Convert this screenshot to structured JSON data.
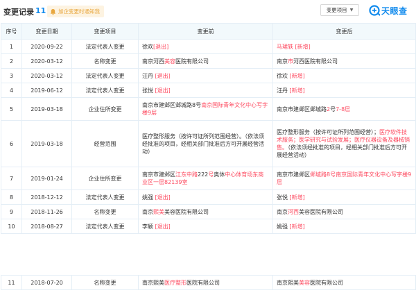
{
  "header": {
    "title": "变更记录",
    "count": "11",
    "notify_label": "加企变更时通知我",
    "dropdown_label": "变更项目",
    "logo_text": "天眼查"
  },
  "columns": [
    "序号",
    "变更日期",
    "变更项目",
    "变更前",
    "变更后"
  ],
  "rows": [
    {
      "no": "1",
      "date": "2020-09-22",
      "item": "法定代表人变更",
      "before": [
        {
          "t": "徐欢"
        },
        {
          "t": "[退出]",
          "hl": true
        }
      ],
      "after": [
        {
          "t": "马珺轶",
          "hl": true
        },
        {
          "t": " [新增]",
          "hl": true
        }
      ]
    },
    {
      "no": "2",
      "date": "2020-03-12",
      "item": "名称变更",
      "before": [
        {
          "t": "南京河西"
        },
        {
          "t": "美容",
          "hl": true
        },
        {
          "t": "医院有限公司"
        }
      ],
      "after": [
        {
          "t": "南京"
        },
        {
          "t": "市",
          "hl": true
        },
        {
          "t": "河西医院有限公司"
        }
      ]
    },
    {
      "no": "3",
      "date": "2020-03-12",
      "item": "法定代表人变更",
      "before": [
        {
          "t": "汪丹 "
        },
        {
          "t": "[退出]",
          "hl": true
        }
      ],
      "after": [
        {
          "t": "徐欢 "
        },
        {
          "t": "[新增]",
          "hl": true
        }
      ]
    },
    {
      "no": "4",
      "date": "2019-06-12",
      "item": "法定代表人变更",
      "before": [
        {
          "t": "张悦 "
        },
        {
          "t": "[退出]",
          "hl": true
        }
      ],
      "after": [
        {
          "t": "汪丹 "
        },
        {
          "t": "[新增]",
          "hl": true
        }
      ]
    },
    {
      "no": "5",
      "date": "2019-03-18",
      "item": "企业住所变更",
      "before": [
        {
          "t": "南京市建邺区邺城路8号"
        },
        {
          "t": "南京国际青年文化中心写字楼9层",
          "hl": true
        }
      ],
      "after": [
        {
          "t": "南京市建邺区邺城路"
        },
        {
          "t": "2",
          "hl": true
        },
        {
          "t": "号"
        },
        {
          "t": "7-8层",
          "hl": true
        }
      ]
    },
    {
      "no": "6",
      "date": "2019-03-18",
      "item": "经营范围",
      "before": [
        {
          "t": "医疗整形服务（按许可证所列范围经营）。（依法须经批准的项目，经相关部门批准后方可开展经营活动）"
        }
      ],
      "after": [
        {
          "t": "医疗整形服务（按许可证所列范围经营）；"
        },
        {
          "t": "医疗软件技术服务；医学研究与试验发展；医疗仪器设备及器械销售。",
          "hl": true
        },
        {
          "t": "（依法须经批准的项目，经相关部门批准后方可开展经营活动）"
        }
      ]
    },
    {
      "no": "7",
      "date": "2019-01-24",
      "item": "企业住所变更",
      "before": [
        {
          "t": "南京市建邺区"
        },
        {
          "t": "江东中路",
          "hl": true
        },
        {
          "t": "222"
        },
        {
          "t": "号",
          "hl": true
        },
        {
          "t": "奥体"
        },
        {
          "t": "中心体育场东商业区一层82139室",
          "hl": true
        }
      ],
      "after": [
        {
          "t": "南京市建邺区"
        },
        {
          "t": "邺城路8号南京国际青年文化",
          "hl": true
        },
        {
          "t": "中心写字楼9层",
          "hl": true
        }
      ]
    },
    {
      "no": "8",
      "date": "2018-12-12",
      "item": "法定代表人变更",
      "before": [
        {
          "t": "姚强 "
        },
        {
          "t": "[退出]",
          "hl": true
        }
      ],
      "after": [
        {
          "t": "张悦 "
        },
        {
          "t": "[新增]",
          "hl": true
        }
      ]
    },
    {
      "no": "9",
      "date": "2018-11-26",
      "item": "名称变更",
      "before": [
        {
          "t": "南京"
        },
        {
          "t": "熙美",
          "hl": true
        },
        {
          "t": "美容医院有限公司"
        }
      ],
      "after": [
        {
          "t": "南京"
        },
        {
          "t": "河西",
          "hl": true
        },
        {
          "t": "美容医院有限公司"
        }
      ]
    },
    {
      "no": "10",
      "date": "2018-08-27",
      "item": "法定代表人变更",
      "before": [
        {
          "t": "李颖 "
        },
        {
          "t": "[退出]",
          "hl": true
        }
      ],
      "after": [
        {
          "t": "姚强 "
        },
        {
          "t": "[新增]",
          "hl": true
        }
      ]
    }
  ],
  "extra_row": {
    "no": "11",
    "date": "2018-07-20",
    "item": "名称变更",
    "before": [
      {
        "t": "南京熙美"
      },
      {
        "t": "医疗整形",
        "hl": true
      },
      {
        "t": "医院有限公司"
      }
    ],
    "after": [
      {
        "t": "南京熙美"
      },
      {
        "t": "美容",
        "hl": true
      },
      {
        "t": "医院有限公司"
      }
    ]
  },
  "colors": {
    "accent": "#128bed",
    "highlight": "#fd485e",
    "header_bg": "#f2f9fc",
    "notify_bg": "#fdf3e1",
    "notify_text": "#e8a73f"
  },
  "icons": {
    "notify": "bell-icon",
    "dropdown": "caret-down-icon",
    "logo": "tianyancha-logo-icon"
  }
}
